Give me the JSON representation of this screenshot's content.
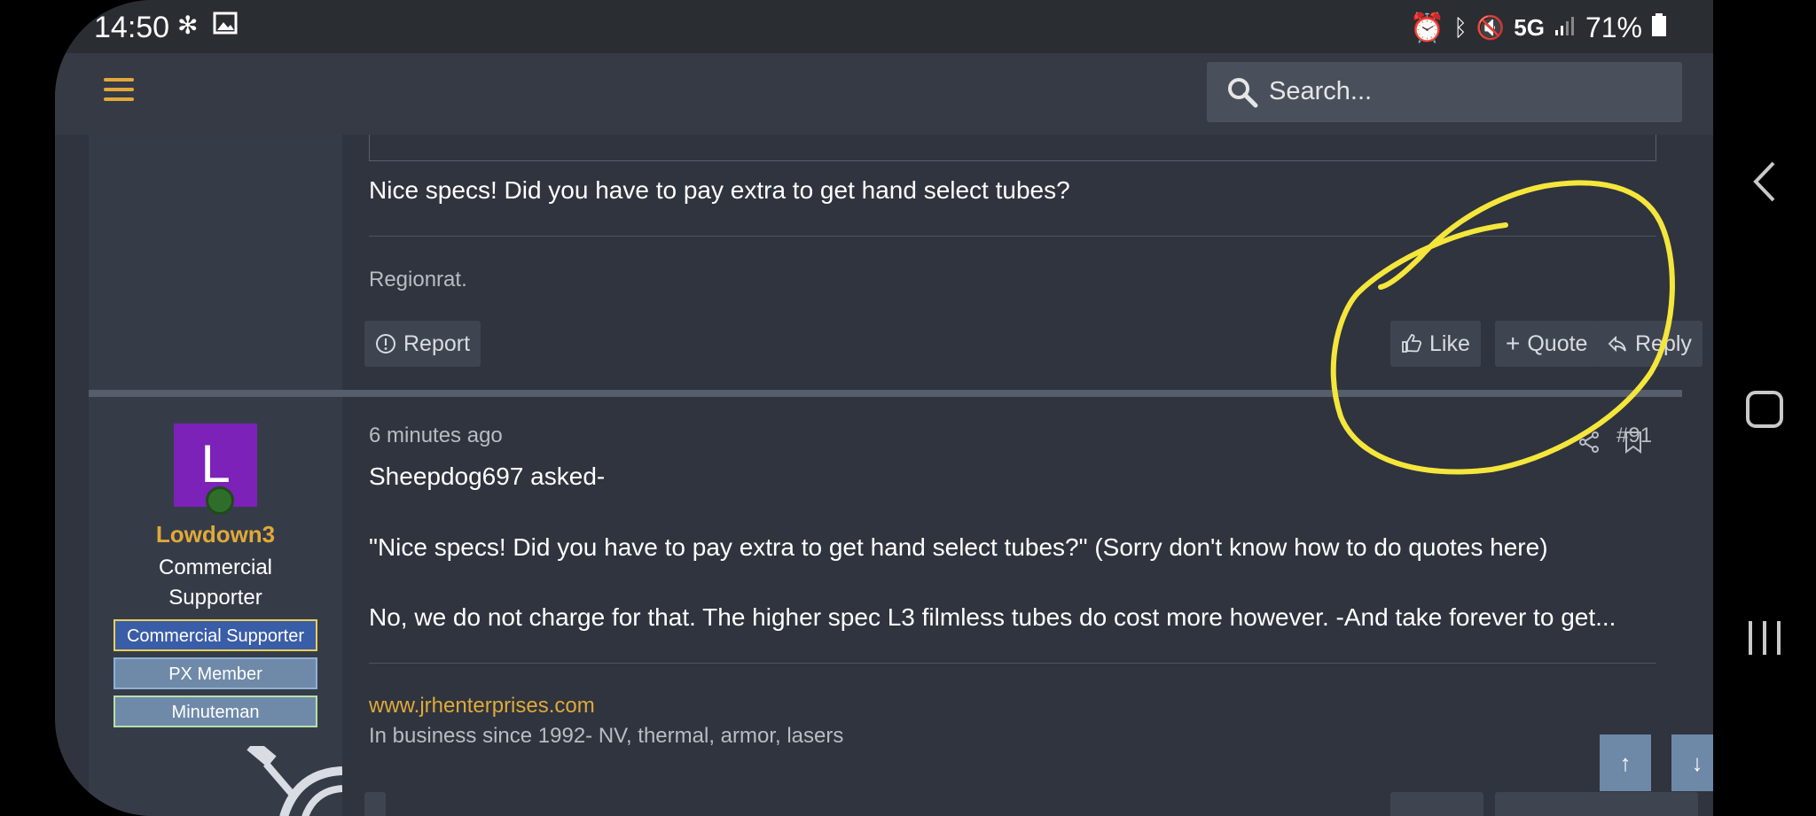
{
  "status_bar": {
    "time": "14:50",
    "network": "5G",
    "battery": "71%"
  },
  "header": {
    "search_placeholder": "Search..."
  },
  "post_prev": {
    "text": "Nice specs! Did you have to pay extra to get hand select tubes?",
    "signature": "Regionrat.",
    "report_label": "Report",
    "like_label": "Like",
    "quote_label": "Quote",
    "reply_label": "Reply"
  },
  "post_current": {
    "author": {
      "avatar_letter": "L",
      "username": "Lowdown3",
      "title_line1": "Commercial",
      "title_line2": "Supporter",
      "banners": [
        "Commercial Supporter",
        "PX Member",
        "Minuteman"
      ]
    },
    "time": "6 minutes ago",
    "number": "#91",
    "lines": [
      "Sheepdog697 asked-",
      "\"Nice specs! Did you have to pay extra to get hand select tubes?\" (Sorry don't know how to do quotes here)",
      "No, we do not charge for that. The higher spec L3 filmless tubes do cost more however. -And take forever to get..."
    ],
    "link": "www.jrhenterprises.com",
    "signature": "In business since 1992- NV, thermal, armor, lasers"
  },
  "colors": {
    "accent": "#e0a93a",
    "annotation": "#f5e63b",
    "background": "#2f343e"
  }
}
